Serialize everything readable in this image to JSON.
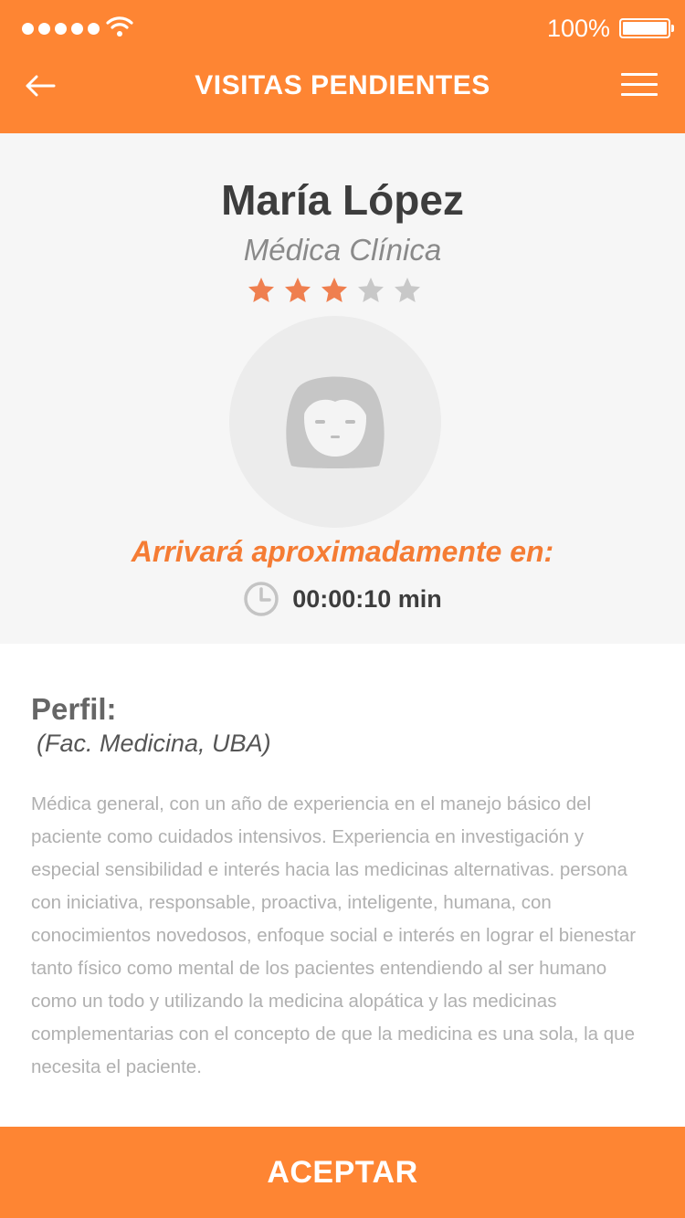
{
  "status_bar": {
    "battery_text": "100%",
    "icons": [
      "signal-dots-icon",
      "wifi-icon",
      "battery-icon"
    ]
  },
  "navbar": {
    "title": "VISITAS PENDIENTES",
    "back_icon": "arrow-left-icon",
    "menu_icon": "hamburger-menu-icon"
  },
  "doctor": {
    "name": "María López",
    "specialty": "Médica Clínica",
    "rating": {
      "value": 3,
      "max": 5
    },
    "avatar_icon": "female-avatar-icon"
  },
  "arrival": {
    "label": "Arrivará aproximadamente en:",
    "time": "00:00:10 min",
    "clock_icon": "clock-icon"
  },
  "profile": {
    "label": "Perfil:",
    "institution": "(Fac. Medicina, UBA)",
    "bio": "Médica general, con un año de experiencia en el manejo básico del paciente como cuidados intensivos. Experiencia en investigación y especial sensibilidad e interés hacia las medicinas alternativas. persona con iniciativa, responsable, proactiva, inteligente, humana, con conocimientos novedosos, enfoque social e interés en lograr el bienestar tanto físico como mental de los pacientes entendiendo al ser humano como un todo y utilizando la medicina alopática y las medicinas complementarias con el concepto de que la medicina es una sola, la que necesita el paciente."
  },
  "accept_button": {
    "label": "ACEPTAR"
  },
  "colors": {
    "brand_orange": "#fe8533",
    "star_filled": "#ef7f4f",
    "star_empty": "#c8c8c8",
    "accent_text": "#f57c34"
  }
}
